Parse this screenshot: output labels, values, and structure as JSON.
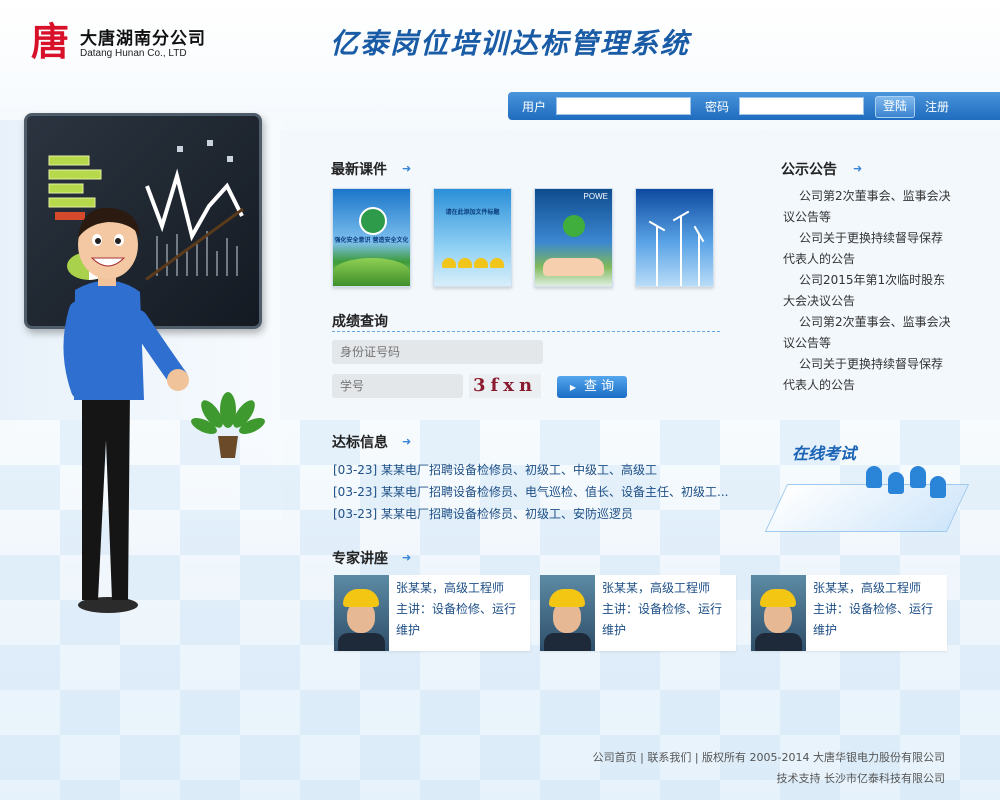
{
  "header": {
    "logo_mark": "唐",
    "logo_name": "大唐湖南分公司",
    "logo_en": "Datang Hunan Co., LTD",
    "system_title": "亿泰岗位培训达标管理系统"
  },
  "login": {
    "user_label": "用户",
    "password_label": "密码",
    "login_button": "登陆",
    "register_link": "注册"
  },
  "courses": {
    "title": "最新课件",
    "items": [
      {
        "caption": "强化安全意识  营造安全文化"
      },
      {
        "caption": "请在此添加文件标题"
      },
      {
        "caption": "POWE"
      },
      {
        "caption": ""
      }
    ]
  },
  "score_query": {
    "title": "成绩查询",
    "id_placeholder": "身份证号码",
    "student_placeholder": "学号",
    "captcha": "3fxn",
    "query_button": "查 询"
  },
  "notices": {
    "title": "公示公告",
    "items": [
      "公司第2次董事会、监事会决议公告等",
      "公司关于更换持续督导保荐代表人的公告",
      "公司2015年第1次临时股东大会决议公告",
      "公司第2次董事会、监事会决议公告等",
      "公司关于更换持续督导保荐代表人的公告"
    ]
  },
  "standard_info": {
    "title": "达标信息",
    "items": [
      "[03-23] 某某电厂招聘设备检修员、初级工、中级工、高级工",
      "[03-23] 某某电厂招聘设备检修员、电气巡检、值长、设备主任、初级工...",
      "[03-23] 某某电厂招聘设备检修员、初级工、安防巡逻员"
    ]
  },
  "online_exam": {
    "title": "在线考试"
  },
  "experts": {
    "title": "专家讲座",
    "items": [
      {
        "name": "张某某，高级工程师",
        "topic": "主讲：设备检修、运行维护"
      },
      {
        "name": "张某某，高级工程师",
        "topic": "主讲：设备检修、运行维护"
      },
      {
        "name": "张某某，高级工程师",
        "topic": "主讲：设备检修、运行维护"
      }
    ]
  },
  "footer": {
    "home": "公司首页",
    "contact": "联系我们",
    "copyright": "版权所有 2005-2014 大唐华银电力股份有限公司",
    "support": "技术支持 长沙市亿泰科技有限公司"
  },
  "colors": {
    "brand_red": "#d8102a",
    "title_blue": "#1a5ba6",
    "bar_blue": "#1f6cbf",
    "link_blue": "#1e4f86"
  }
}
